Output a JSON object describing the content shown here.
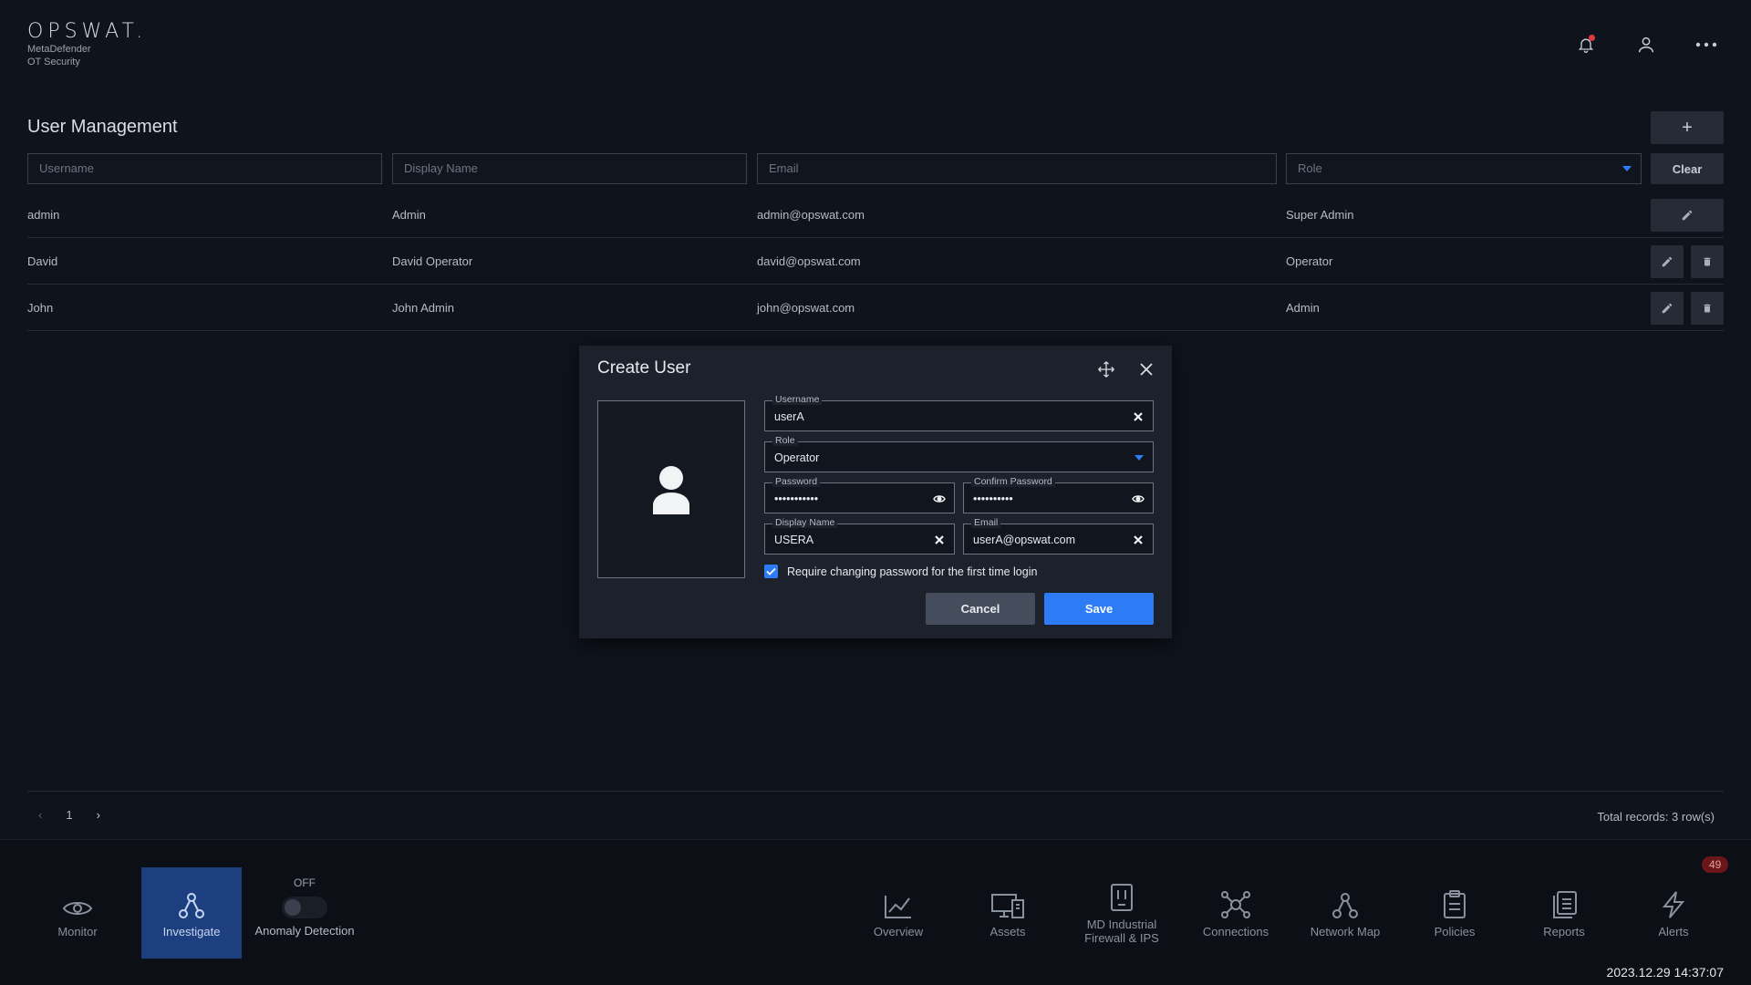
{
  "logo": {
    "brand": "OPSWAT.",
    "line1": "MetaDefender",
    "line2": "OT Security"
  },
  "header": {
    "icons": [
      "bell-icon",
      "user-icon",
      "more-icon"
    ]
  },
  "page": {
    "title": "User Management",
    "add_label": "+"
  },
  "filters": {
    "username_placeholder": "Username",
    "display_name_placeholder": "Display Name",
    "email_placeholder": "Email",
    "role_placeholder": "Role",
    "clear_label": "Clear"
  },
  "users": [
    {
      "username": "admin",
      "display_name": "Admin",
      "email": "admin@opswat.com",
      "role": "Super Admin"
    },
    {
      "username": "David",
      "display_name": "David Operator",
      "email": "david@opswat.com",
      "role": "Operator"
    },
    {
      "username": "John",
      "display_name": "John Admin",
      "email": "john@opswat.com",
      "role": "Admin"
    }
  ],
  "pager": {
    "prev": "‹",
    "page": "1",
    "next": "›",
    "total": "Total records: 3 row(s)"
  },
  "modal": {
    "title": "Create User",
    "username_label": "Username",
    "username_value": "userA",
    "role_label": "Role",
    "role_value": "Operator",
    "password_label": "Password",
    "password_value": "•••••••••••",
    "confirm_label": "Confirm Password",
    "confirm_value": "••••••••••",
    "display_label": "Display Name",
    "display_value": "USERA",
    "email_label": "Email",
    "email_value": "userA@opswat.com",
    "checkbox_label": "Require changing password for the first time login",
    "checkbox_checked": true,
    "cancel_label": "Cancel",
    "save_label": "Save"
  },
  "bottom": {
    "monitor": "Monitor",
    "investigate": "Investigate",
    "toggle_state": "OFF",
    "anomaly": "Anomaly Detection",
    "overview": "Overview",
    "assets": "Assets",
    "firewall_line1": "MD Industrial",
    "firewall_line2": "Firewall & IPS",
    "connections": "Connections",
    "network_map": "Network Map",
    "policies": "Policies",
    "reports": "Reports",
    "alerts": "Alerts",
    "alerts_badge": "49",
    "clock": "2023.12.29 14:37:07"
  },
  "colors": {
    "accent": "#2d7cf6",
    "active_nav": "#1d3f7f",
    "background": "#0f131c",
    "modal": "#1c212c"
  }
}
